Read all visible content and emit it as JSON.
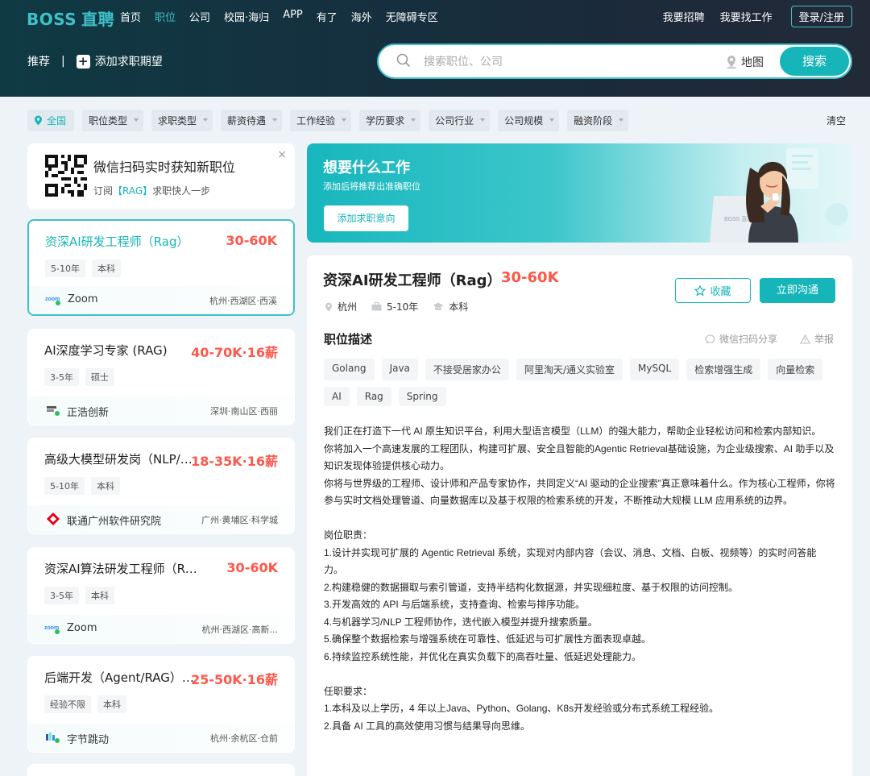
{
  "header": {
    "logo_text": "BOSS",
    "logo_sub": "直聘",
    "nav": [
      "首页",
      "职位",
      "公司",
      "校园·海归",
      "APP",
      "有了",
      "海外",
      "无障碍专区"
    ],
    "active_nav": "职位",
    "right_links": [
      "我要招聘",
      "我要找工作"
    ],
    "login_label": "登录/注册"
  },
  "preference": {
    "label": "推荐",
    "separator": "|",
    "add_label": "添加求职期望"
  },
  "search": {
    "placeholder": "搜索职位、公司",
    "map_label": "地图",
    "button_label": "搜索"
  },
  "filters": {
    "city": "全国",
    "items": [
      "职位类型",
      "求职类型",
      "薪资待遇",
      "工作经验",
      "学历要求",
      "公司行业",
      "公司规模",
      "融资阶段"
    ],
    "clear_label": "清空"
  },
  "qr_card": {
    "title": "微信扫码实时获知新职位",
    "sub_prefix": "订阅",
    "sub_highlight": "【RAG】",
    "sub_suffix": "求职快人一步",
    "close": "×"
  },
  "jobs": [
    {
      "title": "资深AI研发工程师（Rag）",
      "salary": "30-60K",
      "tags": [
        "5-10年",
        "本科"
      ],
      "company": "Zoom",
      "location": "杭州·西湖区·西溪",
      "logo": "zoom"
    },
    {
      "title": "AI深度学习专家 (RAG)",
      "salary": "40-70K·16薪",
      "tags": [
        "3-5年",
        "硕士"
      ],
      "company": "正浩创新",
      "location": "深圳·南山区·西丽",
      "logo": "zhenghao"
    },
    {
      "title": "高级大模型研发岗（NLP/RAG）",
      "salary": "18-35K·16薪",
      "tags": [
        "5-10年",
        "本科"
      ],
      "company": "联通广州软件研究院",
      "location": "广州·黄埔区·科学城",
      "logo": "unicom"
    },
    {
      "title": "资深AI算法研发工程师（Rag）",
      "salary": "30-60K",
      "tags": [
        "3-5年",
        "本科"
      ],
      "company": "Zoom",
      "location": "杭州·西湖区·高新...",
      "logo": "zoom"
    },
    {
      "title": "后端开发（Agent/RAG）-...",
      "salary": "25-50K·16薪",
      "tags": [
        "经验不限",
        "本科"
      ],
      "company": "字节跳动",
      "location": "杭州·余杭区·仓前",
      "logo": "bytedance"
    }
  ],
  "banner": {
    "title": "想要什么工作",
    "subtitle": "添加后将推荐出准确职位",
    "button_label": "添加求职意向",
    "laptop_text": "BOSS 直聘"
  },
  "detail": {
    "title": "资深AI研发工程师（Rag）",
    "salary": "30-60K",
    "city": "杭州",
    "experience": "5-10年",
    "degree": "本科",
    "fav_label": "收藏",
    "chat_label": "立即沟通",
    "section_title": "职位描述",
    "share_label": "微信扫码分享",
    "report_label": "举报",
    "skills": [
      "Golang",
      "Java",
      "不接受居家办公",
      "阿里淘天/通义实验室",
      "MySQL",
      "检索增强生成",
      "向量检索",
      "AI",
      "Rag",
      "Spring"
    ],
    "description": "我们正在打造下一代 AI 原生知识平台，利用大型语言模型（LLM）的强大能力，帮助企业轻松访问和检索内部知识。\n你将加入一个高速发展的工程团队，构建可扩展、安全且智能的Agentic Retrieval基础设施，为企业级搜索、AI 助手以及知识发现体验提供核心动力。\n你将与世界级的工程师、设计师和产品专家协作，共同定义“AI 驱动的企业搜索”真正意味着什么。作为核心工程师，你将参与实时文档处理管道、向量数据库以及基于权限的检索系统的开发，不断推动大规模 LLM 应用系统的边界。\n\n岗位职责：\n1.设计并实现可扩展的 Agentic Retrieval 系统，实现对内部内容（会议、消息、文档、白板、视频等）的实时问答能力。\n2.构建稳健的数据摄取与索引管道，支持半结构化数据源，并实现细粒度、基于权限的访问控制。\n3.开发高效的 API 与后端系统，支持查询、检索与排序功能。\n4.与机器学习/NLP 工程师协作，迭代嵌入模型并提升搜索质量。\n5.确保整个数据检索与增强系统在可靠性、低延迟与可扩展性方面表现卓越。\n6.持续监控系统性能，并优化在真实负载下的高吞吐量、低延迟处理能力。\n\n任职要求：\n1.本科及以上学历，4 年以上Java、Python、Golang、K8s开发经验或分布式系统工程经验。\n2.具备 AI 工具的高效使用习惯与结果导向思维。"
  },
  "colors": {
    "accent": "#16b5b9",
    "salary": "#fe574a"
  }
}
